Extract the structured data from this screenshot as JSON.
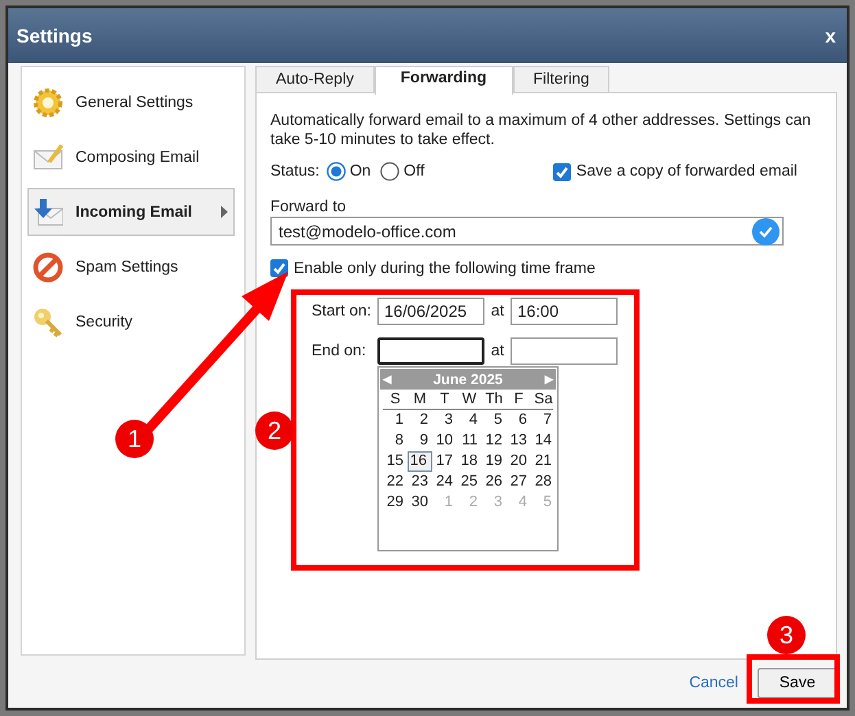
{
  "window": {
    "title": "Settings",
    "close": "x"
  },
  "sidebar": {
    "items": [
      {
        "label": "General Settings",
        "selected": false
      },
      {
        "label": "Composing Email",
        "selected": false
      },
      {
        "label": "Incoming Email",
        "selected": true
      },
      {
        "label": "Spam Settings",
        "selected": false
      },
      {
        "label": "Security",
        "selected": false
      }
    ]
  },
  "tabs": [
    {
      "label": "Auto-Reply",
      "selected": false
    },
    {
      "label": "Forwarding",
      "selected": true
    },
    {
      "label": "Filtering",
      "selected": false
    }
  ],
  "description": "Automatically forward email to a maximum of 4 other addresses. Settings can take 5-10 minutes to take effect.",
  "status": {
    "label": "Status:",
    "options": [
      {
        "label": "On",
        "selected": true
      },
      {
        "label": "Off",
        "selected": false
      }
    ]
  },
  "save_copy": {
    "label": "Save a copy of forwarded email",
    "checked": true
  },
  "forward_to": {
    "label": "Forward to",
    "value": "test@modelo-office.com"
  },
  "time_frame": {
    "label": "Enable only during the following time frame",
    "checked": true
  },
  "start": {
    "label": "Start on:",
    "date": "16/06/2025",
    "at": "at",
    "time": "16:00"
  },
  "end": {
    "label": "End on:",
    "at": "at"
  },
  "calendar": {
    "month": "June 2025",
    "prev": "◀",
    "next": "▶",
    "weekdays": [
      "S",
      "M",
      "T",
      "W",
      "Th",
      "F",
      "Sa"
    ],
    "weeks": [
      [
        {
          "day": "1",
          "other_month": false,
          "selected": false
        },
        {
          "day": "2",
          "other_month": false,
          "selected": false
        },
        {
          "day": "3",
          "other_month": false,
          "selected": false
        },
        {
          "day": "4",
          "other_month": false,
          "selected": false
        },
        {
          "day": "5",
          "other_month": false,
          "selected": false
        },
        {
          "day": "6",
          "other_month": false,
          "selected": false
        },
        {
          "day": "7",
          "other_month": false,
          "selected": false
        }
      ],
      [
        {
          "day": "8",
          "other_month": false,
          "selected": false
        },
        {
          "day": "9",
          "other_month": false,
          "selected": false
        },
        {
          "day": "10",
          "other_month": false,
          "selected": false
        },
        {
          "day": "11",
          "other_month": false,
          "selected": false
        },
        {
          "day": "12",
          "other_month": false,
          "selected": false
        },
        {
          "day": "13",
          "other_month": false,
          "selected": false
        },
        {
          "day": "14",
          "other_month": false,
          "selected": false
        }
      ],
      [
        {
          "day": "15",
          "other_month": false,
          "selected": false
        },
        {
          "day": "16",
          "other_month": false,
          "selected": true
        },
        {
          "day": "17",
          "other_month": false,
          "selected": false
        },
        {
          "day": "18",
          "other_month": false,
          "selected": false
        },
        {
          "day": "19",
          "other_month": false,
          "selected": false
        },
        {
          "day": "20",
          "other_month": false,
          "selected": false
        },
        {
          "day": "21",
          "other_month": false,
          "selected": false
        }
      ],
      [
        {
          "day": "22",
          "other_month": false,
          "selected": false
        },
        {
          "day": "23",
          "other_month": false,
          "selected": false
        },
        {
          "day": "24",
          "other_month": false,
          "selected": false
        },
        {
          "day": "25",
          "other_month": false,
          "selected": false
        },
        {
          "day": "26",
          "other_month": false,
          "selected": false
        },
        {
          "day": "27",
          "other_month": false,
          "selected": false
        },
        {
          "day": "28",
          "other_month": false,
          "selected": false
        }
      ],
      [
        {
          "day": "29",
          "other_month": false,
          "selected": false
        },
        {
          "day": "30",
          "other_month": false,
          "selected": false
        },
        {
          "day": "1",
          "other_month": true,
          "selected": false
        },
        {
          "day": "2",
          "other_month": true,
          "selected": false
        },
        {
          "day": "3",
          "other_month": true,
          "selected": false
        },
        {
          "day": "4",
          "other_month": true,
          "selected": false
        },
        {
          "day": "5",
          "other_month": true,
          "selected": false
        }
      ]
    ]
  },
  "buttons": {
    "cancel": "Cancel",
    "save": "Save"
  },
  "annotations": [
    {
      "label": "1"
    },
    {
      "label": "2"
    },
    {
      "label": "3"
    }
  ]
}
